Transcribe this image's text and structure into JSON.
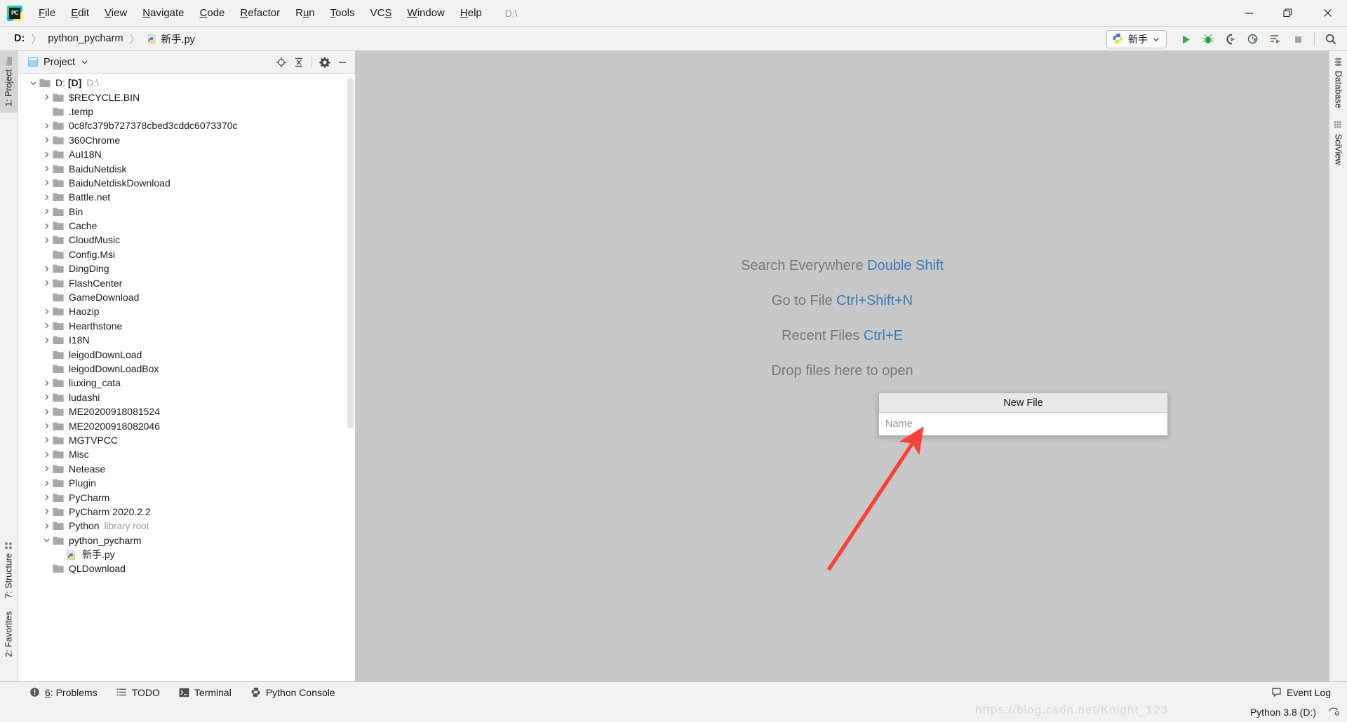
{
  "window": {
    "title": "D:\\",
    "controls": {
      "minimize": "minimize-button",
      "restore": "restore-button",
      "close": "close-button"
    }
  },
  "menubar": {
    "logo": "pycharm-logo",
    "items": [
      {
        "label": "File",
        "mnemonic": "F"
      },
      {
        "label": "Edit",
        "mnemonic": "E"
      },
      {
        "label": "View",
        "mnemonic": "V"
      },
      {
        "label": "Navigate",
        "mnemonic": "N"
      },
      {
        "label": "Code",
        "mnemonic": "C"
      },
      {
        "label": "Refactor",
        "mnemonic": "R"
      },
      {
        "label": "Run",
        "mnemonic": "u"
      },
      {
        "label": "Tools",
        "mnemonic": "T"
      },
      {
        "label": "VCS",
        "mnemonic": "S"
      },
      {
        "label": "Window",
        "mnemonic": "W"
      },
      {
        "label": "Help",
        "mnemonic": "H"
      }
    ]
  },
  "navbar": {
    "breadcrumbs": [
      {
        "label": "D:",
        "icon": null,
        "bold": true
      },
      {
        "label": "python_pycharm",
        "icon": null,
        "bold": false
      },
      {
        "label": "新手.py",
        "icon": "python-file-icon",
        "bold": false
      }
    ],
    "run_config": {
      "label": "新手",
      "icon": "python-icon",
      "chevron": "chevron-down-icon"
    },
    "buttons": [
      {
        "name": "run-button",
        "title": "Run"
      },
      {
        "name": "debug-button",
        "title": "Debug"
      },
      {
        "name": "run-with-coverage-button",
        "title": "Run with Coverage"
      },
      {
        "name": "profile-button",
        "title": "Profile"
      },
      {
        "name": "run-tests-button",
        "title": "Run Tests"
      },
      {
        "name": "stop-button",
        "title": "Stop"
      },
      {
        "name": "search-button",
        "title": "Search Everywhere"
      }
    ]
  },
  "left_stripe": {
    "items": [
      {
        "label": "1: Project",
        "active": true
      },
      {
        "label": "7: Structure",
        "active": false
      },
      {
        "label": "2: Favorites",
        "active": false
      }
    ]
  },
  "right_stripe": {
    "items": [
      {
        "label": "Database",
        "icon": "database-icon"
      },
      {
        "label": "SciView",
        "icon": "grid-icon"
      }
    ]
  },
  "project_panel": {
    "title": "Project",
    "dropdown": "chevron-down-icon",
    "actions": [
      {
        "name": "locate-file-button",
        "icon": "crosshair-icon"
      },
      {
        "name": "collapse-all-button",
        "icon": "collapse-icon"
      },
      {
        "name": "settings-button",
        "icon": "gear-icon"
      },
      {
        "name": "hide-panel-button",
        "icon": "minimize-icon"
      }
    ],
    "tree": [
      {
        "label": "D: [D]",
        "sub": "D:\\",
        "depth": 0,
        "state": "expanded",
        "boldPart": "[D]",
        "type": "folder"
      },
      {
        "label": "$RECYCLE.BIN",
        "depth": 1,
        "state": "collapsed",
        "type": "folder"
      },
      {
        "label": ".temp",
        "depth": 1,
        "state": "leaf",
        "type": "folder"
      },
      {
        "label": "0c8fc379b727378cbed3cddc6073370c",
        "depth": 1,
        "state": "collapsed",
        "type": "folder"
      },
      {
        "label": "360Chrome",
        "depth": 1,
        "state": "collapsed",
        "type": "folder"
      },
      {
        "label": "AuI18N",
        "depth": 1,
        "state": "collapsed",
        "type": "folder"
      },
      {
        "label": "BaiduNetdisk",
        "depth": 1,
        "state": "collapsed",
        "type": "folder"
      },
      {
        "label": "BaiduNetdiskDownload",
        "depth": 1,
        "state": "collapsed",
        "type": "folder"
      },
      {
        "label": "Battle.net",
        "depth": 1,
        "state": "collapsed",
        "type": "folder"
      },
      {
        "label": "Bin",
        "depth": 1,
        "state": "collapsed",
        "type": "folder"
      },
      {
        "label": "Cache",
        "depth": 1,
        "state": "collapsed",
        "type": "folder"
      },
      {
        "label": "CloudMusic",
        "depth": 1,
        "state": "collapsed",
        "type": "folder"
      },
      {
        "label": "Config.Msi",
        "depth": 1,
        "state": "leaf",
        "type": "folder"
      },
      {
        "label": "DingDing",
        "depth": 1,
        "state": "collapsed",
        "type": "folder"
      },
      {
        "label": "FlashCenter",
        "depth": 1,
        "state": "collapsed",
        "type": "folder"
      },
      {
        "label": "GameDownload",
        "depth": 1,
        "state": "leaf",
        "type": "folder"
      },
      {
        "label": "Haozip",
        "depth": 1,
        "state": "collapsed",
        "type": "folder"
      },
      {
        "label": "Hearthstone",
        "depth": 1,
        "state": "collapsed",
        "type": "folder"
      },
      {
        "label": "I18N",
        "depth": 1,
        "state": "collapsed",
        "type": "folder"
      },
      {
        "label": "leigodDownLoad",
        "depth": 1,
        "state": "leaf",
        "type": "folder"
      },
      {
        "label": "leigodDownLoadBox",
        "depth": 1,
        "state": "leaf",
        "type": "folder"
      },
      {
        "label": "liuxing_cata",
        "depth": 1,
        "state": "collapsed",
        "type": "folder"
      },
      {
        "label": "ludashi",
        "depth": 1,
        "state": "collapsed",
        "type": "folder"
      },
      {
        "label": "ME20200918081524",
        "depth": 1,
        "state": "collapsed",
        "type": "folder"
      },
      {
        "label": "ME20200918082046",
        "depth": 1,
        "state": "collapsed",
        "type": "folder"
      },
      {
        "label": "MGTVPCC",
        "depth": 1,
        "state": "collapsed",
        "type": "folder"
      },
      {
        "label": "Misc",
        "depth": 1,
        "state": "collapsed",
        "type": "folder"
      },
      {
        "label": "Netease",
        "depth": 1,
        "state": "collapsed",
        "type": "folder"
      },
      {
        "label": "Plugin",
        "depth": 1,
        "state": "collapsed",
        "type": "folder"
      },
      {
        "label": "PyCharm",
        "depth": 1,
        "state": "collapsed",
        "type": "folder"
      },
      {
        "label": "PyCharm 2020.2.2",
        "depth": 1,
        "state": "collapsed",
        "type": "folder"
      },
      {
        "label": "Python",
        "sub": "library root",
        "depth": 1,
        "state": "collapsed",
        "type": "folder"
      },
      {
        "label": "python_pycharm",
        "depth": 1,
        "state": "expanded",
        "type": "folder"
      },
      {
        "label": "新手.py",
        "depth": 2,
        "state": "leaf",
        "type": "python-file"
      },
      {
        "label": "QLDownload",
        "depth": 1,
        "state": "leaf",
        "type": "folder"
      }
    ]
  },
  "editor": {
    "hints": [
      {
        "text": "Search Everywhere ",
        "shortcut": "Double Shift"
      },
      {
        "text": "Go to File ",
        "shortcut": "Ctrl+Shift+N"
      },
      {
        "text": "Recent Files ",
        "shortcut": "Ctrl+E"
      }
    ],
    "drop_text": "Drop files here to open"
  },
  "new_file_dialog": {
    "title": "New File",
    "input_placeholder": "Name",
    "input_value": ""
  },
  "annotation": {
    "arrow_color": "#F8413A",
    "name": "red-arrow-annotation"
  },
  "bottom_bar": {
    "items": [
      {
        "label": "6: Problems",
        "mnemonic": "6",
        "icon": "error-icon"
      },
      {
        "label": "TODO",
        "mnemonic": "",
        "icon": "list-icon"
      },
      {
        "label": "Terminal",
        "mnemonic": "",
        "icon": "terminal-icon"
      },
      {
        "label": "Python Console",
        "mnemonic": "",
        "icon": "python-icon"
      }
    ],
    "event_log": {
      "label": "Event Log",
      "icon": "balloon-icon"
    }
  },
  "status_bar": {
    "interpreter": "Python 3.8 (D:)",
    "interpreter_icon": "settings-gear-icon",
    "watermark": "https://blog.csdn.net/Knight_123"
  },
  "colors": {
    "accent_blue": "#3b7ab5",
    "hint_gray": "#777777",
    "panel_bg": "#f2f2f2",
    "editor_bg": "#c8c8c8",
    "tree_bg": "#ffffff",
    "arrow_red": "#F8413A",
    "run_green": "#3cab43"
  }
}
